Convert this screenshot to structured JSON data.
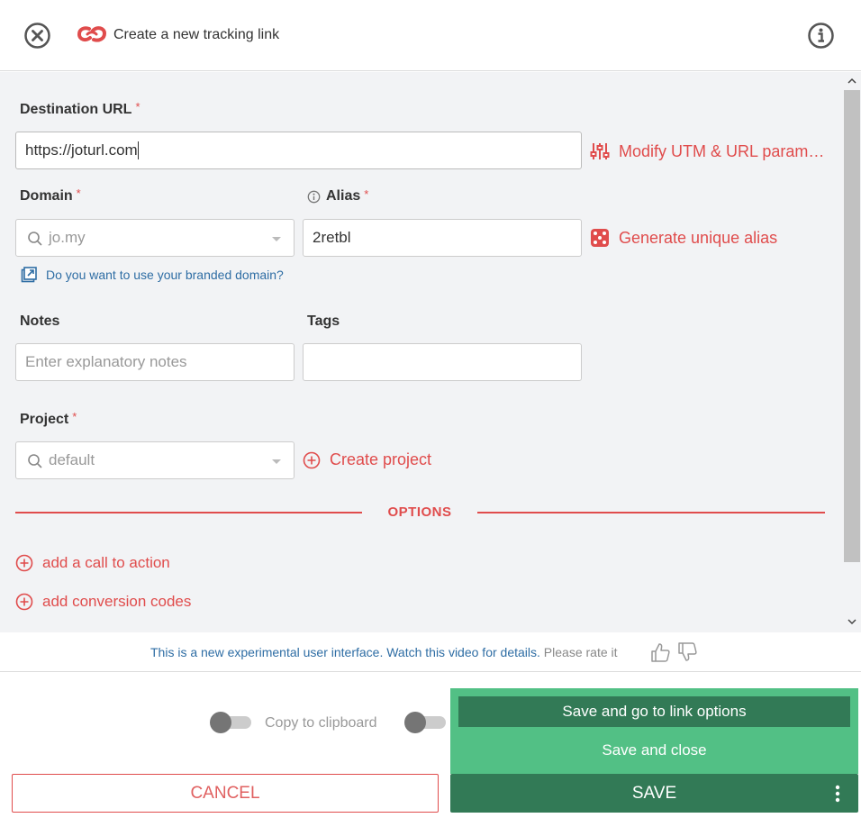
{
  "header": {
    "title": "Create a new tracking link"
  },
  "form": {
    "destination_label": "Destination URL",
    "destination_value": "https://joturl.com",
    "utm_link": "Modify UTM & URL param…",
    "domain_label": "Domain",
    "domain_value": "jo.my",
    "alias_label": "Alias",
    "alias_value": "2retbl",
    "generate_alias_link": "Generate unique alias",
    "branded_domain_link": "Do you want to use your branded domain?",
    "notes_label": "Notes",
    "notes_placeholder": "Enter explanatory notes",
    "tags_label": "Tags",
    "project_label": "Project",
    "project_value": "default",
    "create_project_link": "Create project",
    "options_heading": "OPTIONS",
    "call_to_action_link": "add a call to action",
    "conversion_codes_link": "add conversion codes",
    "required_mark": "*"
  },
  "infobar": {
    "experimental_text": "This is a new experimental user interface. Watch this video for details.",
    "rate_text": "Please rate it"
  },
  "footer": {
    "copy_clipboard_label": "Copy to clipboard",
    "menu": {
      "save_go_options": "Save and go to link options",
      "save_close": "Save and close"
    },
    "cancel_label": "CANCEL",
    "save_label": "SAVE"
  },
  "colors": {
    "accent_red": "#e04c4c",
    "link_blue": "#2e6da4",
    "save_green": "#327a56",
    "menu_green": "#52c085"
  }
}
